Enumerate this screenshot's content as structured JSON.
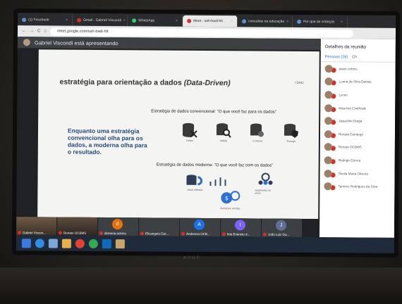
{
  "browser": {
    "tabs": [
      "(1) Facebook",
      "Gmail - Gabriel Viscondi",
      "WhatsApp",
      "Meet - sah-badi-hit",
      "consultas na educação",
      "Por que as crianças"
    ],
    "url": "meet.google.com/sah-badi-hit"
  },
  "meet": {
    "presenting": "Gabriel Viscondi está apresentando",
    "panel_title": "Detalhes da reunião",
    "people_tab": "Pessoas (28)",
    "chat_tab": "Ch",
    "people": [
      "joanir ocbms",
      "Luana da Silva Dantas",
      "Lucas",
      "Maurício Chalhoub",
      "Jaqueline Braga",
      "Renata Camargo",
      "Renato OCBMS",
      "Rodrigo Correa",
      "Sheila Maria Oliveira",
      "Tamires Rodrigues da Silva"
    ],
    "tiles": [
      {
        "name": "Gabriel Viscon...",
        "letter": "",
        "color": "#6e5a46"
      },
      {
        "name": "Renato OCBMS",
        "letter": "",
        "color": "#5c4d3e"
      },
      {
        "name": "diretoria ocbms",
        "letter": "d",
        "color": "#e8710a"
      },
      {
        "name": "Elizangela Gar...",
        "letter": "",
        "color": "#3c4043"
      },
      {
        "name": "Andressa OCB...",
        "letter": "A",
        "color": "#1a73e8"
      },
      {
        "name": "Ilda Evaristo d...",
        "letter": "I",
        "color": "#7b61ff"
      },
      {
        "name": "João Luiz Go...",
        "letter": "J",
        "color": "#5f6f98"
      }
    ]
  },
  "slide": {
    "title": "estratégia para orientação a dados",
    "title_em": "(Data-Driven)",
    "tag": "/ DHO",
    "left_text": "Enquanto uma estratégia convencional olha para os dados, a moderna olha para o resultado.",
    "conv_label": "Estratégia de dados convencional: \"O que você faz para os dados\"",
    "mod_label": "Estratégia de dados moderna: \"O que você faz com os dados\"",
    "conv_icons": [
      "Limpa",
      "Valida",
      "Controla",
      "Protege"
    ],
    "mod_icons": [
      "Atrair clientes",
      "Segmentar os alvos",
      "Aumentar vendas"
    ]
  },
  "monitor": {
    "brand": "ASUS"
  }
}
